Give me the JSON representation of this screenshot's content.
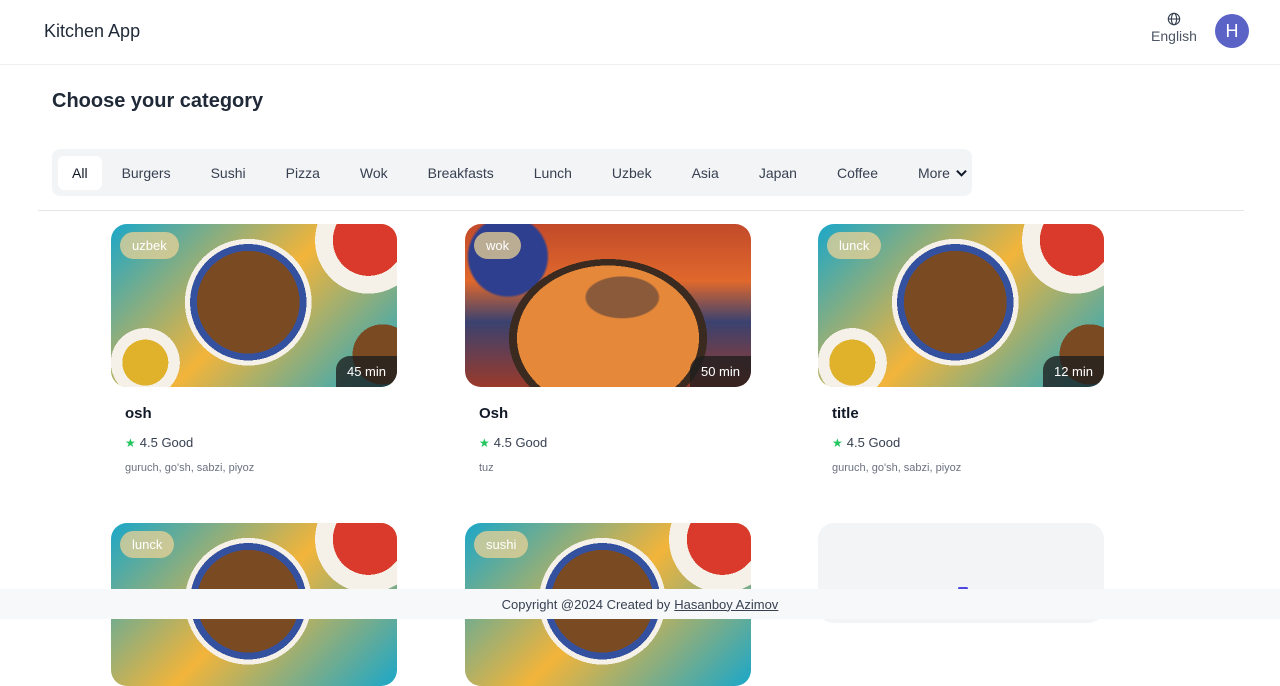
{
  "header": {
    "brand": "Kitchen App",
    "language": "English",
    "avatar_letter": "H"
  },
  "page_title": "Choose your category",
  "categories": [
    "All",
    "Burgers",
    "Sushi",
    "Pizza",
    "Wok",
    "Breakfasts",
    "Lunch",
    "Uzbek",
    "Asia",
    "Japan",
    "Coffee",
    "More"
  ],
  "active_category": "All",
  "cards": [
    {
      "tag": "uzbek",
      "time": "45 min",
      "title": "osh",
      "rating": "4.5 Good",
      "ingredients": "guruch, go'sh, sabzi, piyoz"
    },
    {
      "tag": "wok",
      "time": "50 min",
      "title": "Osh",
      "rating": "4.5 Good",
      "ingredients": "tuz"
    },
    {
      "tag": "lunck",
      "time": "12 min",
      "title": "title",
      "rating": "4.5 Good",
      "ingredients": "guruch, go'sh, sabzi, piyoz"
    },
    {
      "tag": "lunck"
    },
    {
      "tag": "sushi"
    }
  ],
  "footer": {
    "text": "Copyright @2024 Created by",
    "author": "Hasanboy Azimov"
  },
  "colors": {
    "accent": "#5b63c7",
    "star": "#22c55e",
    "category_bar": "#f3f4f6"
  }
}
